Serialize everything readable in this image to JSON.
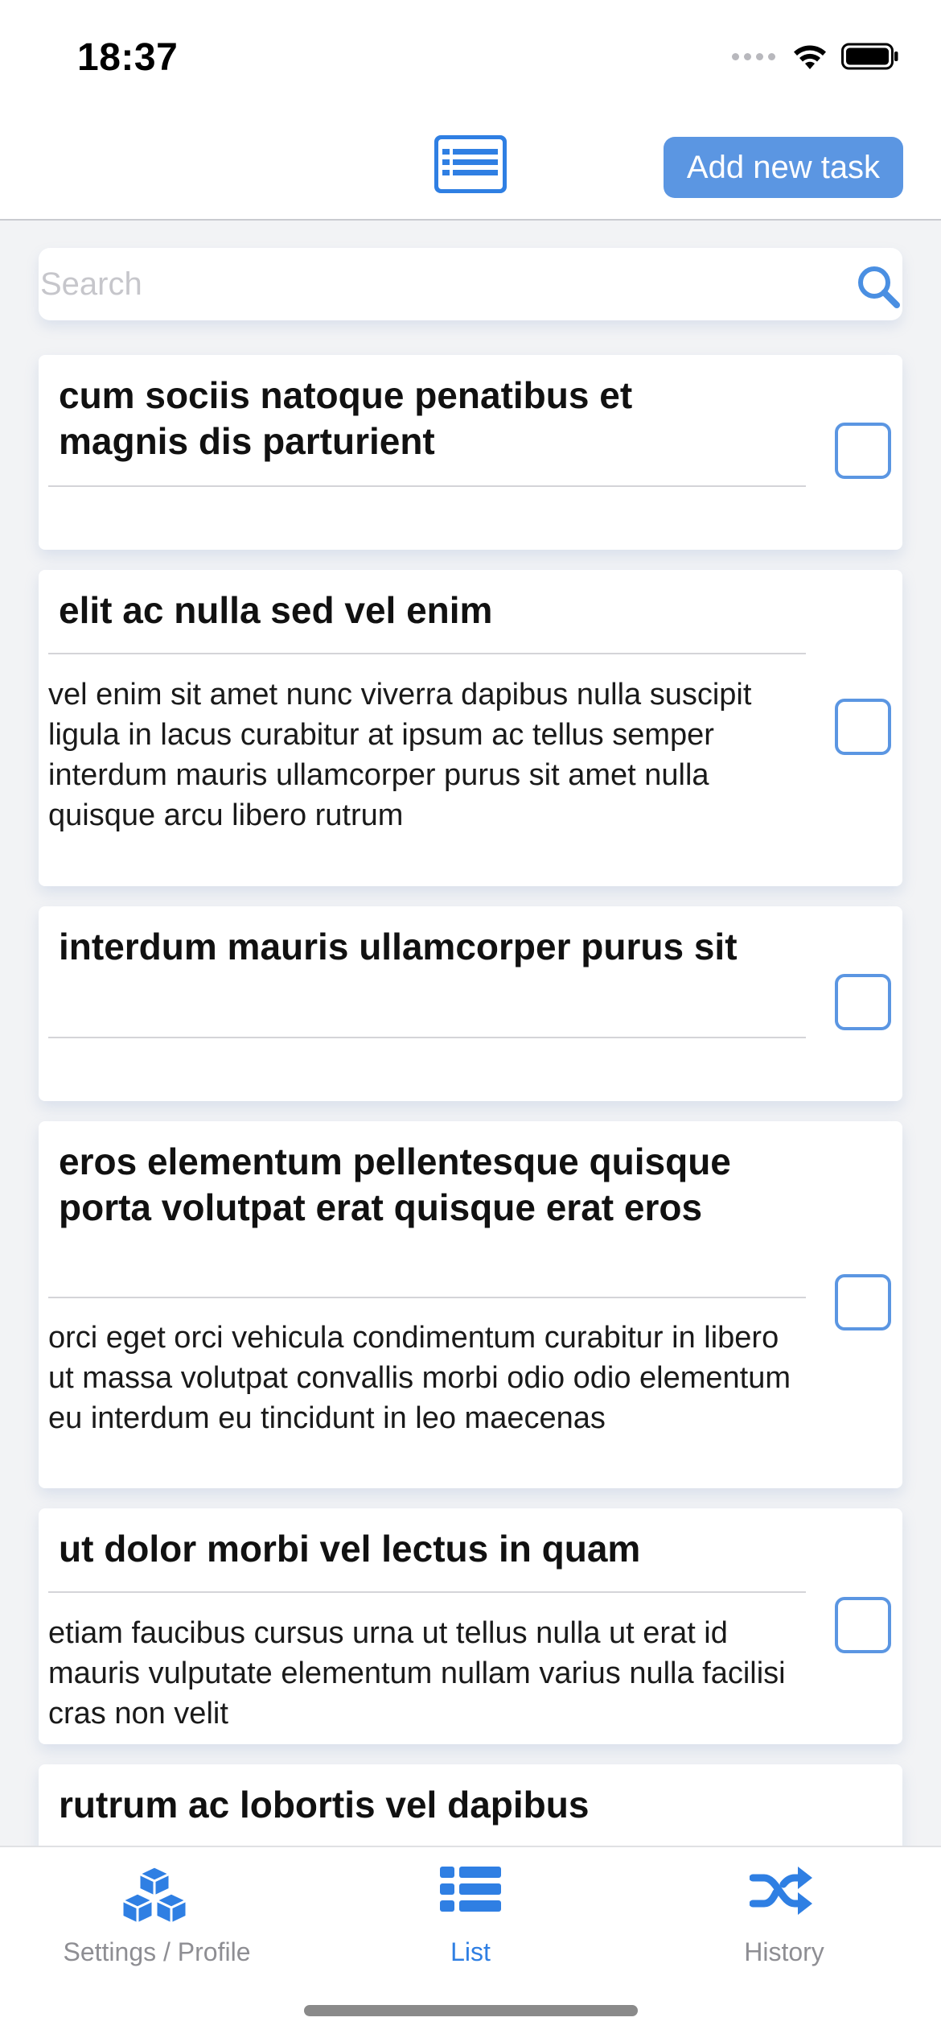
{
  "status_bar": {
    "time": "18:37",
    "icons": [
      "cellular-signal-icon",
      "wifi-icon",
      "battery-icon"
    ]
  },
  "nav_bar": {
    "center_icon": "list-icon",
    "add_button_label": "Add new task"
  },
  "search": {
    "placeholder": "Search",
    "value": "",
    "icon": "search-icon"
  },
  "tasks": [
    {
      "title": "cum sociis natoque penatibus et magnis dis parturient",
      "description": "",
      "checked": false
    },
    {
      "title": "elit ac nulla sed vel enim",
      "description": "vel enim sit amet nunc viverra dapibus nulla suscipit ligula in lacus curabitur at ipsum ac tellus semper interdum mauris ullamcorper purus sit amet nulla quisque arcu libero rutrum",
      "checked": false
    },
    {
      "title": "interdum mauris ullamcorper purus sit",
      "description": "",
      "checked": false
    },
    {
      "title": "eros elementum pellentesque quisque porta volutpat erat quisque erat eros",
      "description": "orci eget orci vehicula condimentum curabitur in libero ut massa volutpat convallis morbi odio odio elementum eu interdum eu tincidunt in leo maecenas",
      "checked": false
    },
    {
      "title": "ut dolor morbi vel lectus in quam",
      "description": "etiam faucibus cursus urna ut tellus nulla ut erat id mauris vulputate elementum nullam varius nulla facilisi cras non velit",
      "checked": false
    },
    {
      "title": "rutrum ac lobortis vel dapibus",
      "description": "",
      "checked": false
    }
  ],
  "tab_bar": {
    "items": [
      {
        "label": "Settings / Profile",
        "icon": "cubes-icon",
        "active": false
      },
      {
        "label": "List",
        "icon": "list-icon",
        "active": true
      },
      {
        "label": "History",
        "icon": "shuffle-icon",
        "active": false
      }
    ]
  },
  "colors": {
    "accent": "#5b96e2",
    "tab_active": "#2f7fe3",
    "tab_inactive": "#8e8e93",
    "background": "#f2f3f5"
  }
}
